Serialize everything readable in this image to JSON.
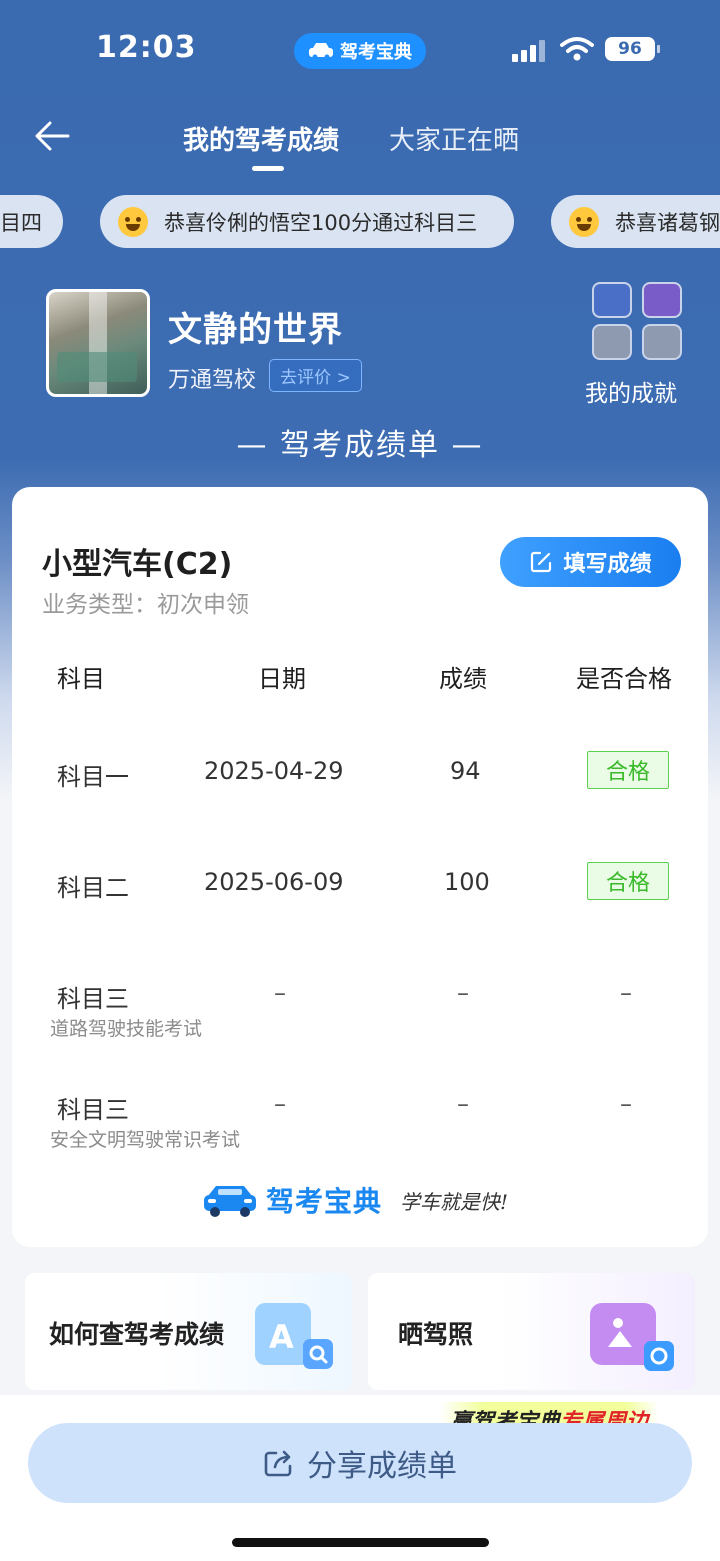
{
  "status_bar": {
    "time": "12:03",
    "app_badge": "驾考宝典",
    "battery": "96"
  },
  "nav": {
    "tabs": [
      {
        "label": "我的驾考成绩",
        "active": true
      },
      {
        "label": "大家正在晒",
        "active": false
      }
    ]
  },
  "ticker": [
    "目四",
    "恭喜伶俐的悟空100分通过科目三",
    "恭喜诸葛钢"
  ],
  "profile": {
    "name": "文静的世界",
    "school": "万通驾校",
    "review_label": "去评价 >",
    "achievements_label": "我的成就"
  },
  "sheet_title": "— 驾考成绩单 —",
  "card": {
    "vehicle": "小型汽车(C2)",
    "business_type": "业务类型：初次申领",
    "fill_button": "填写成绩",
    "headers": [
      "科目",
      "日期",
      "成绩",
      "是否合格"
    ],
    "rows": [
      {
        "subject": "科目一",
        "note": "",
        "date": "2025-04-29",
        "score": "94",
        "result": "合格"
      },
      {
        "subject": "科目二",
        "note": "",
        "date": "2025-06-09",
        "score": "100",
        "result": "合格"
      },
      {
        "subject": "科目三",
        "note": "道路驾驶技能考试",
        "date": "–",
        "score": "–",
        "result": "–"
      },
      {
        "subject": "科目三",
        "note": "安全文明驾驶常识考试",
        "date": "–",
        "score": "–",
        "result": "–"
      }
    ],
    "logo_text": "驾考宝典",
    "slogan": "学车就是快!"
  },
  "help_tiles": [
    {
      "label": "如何查驾考成绩"
    },
    {
      "label": "晒驾照"
    }
  ],
  "promo": {
    "prefix": "赢驾考宝典",
    "highlight": "专属周边"
  },
  "share_button": "分享成绩单",
  "colors": {
    "header_blue": "#3a6ab0",
    "accent": "#1a7ef0",
    "pass_green": "#3aba2a"
  }
}
